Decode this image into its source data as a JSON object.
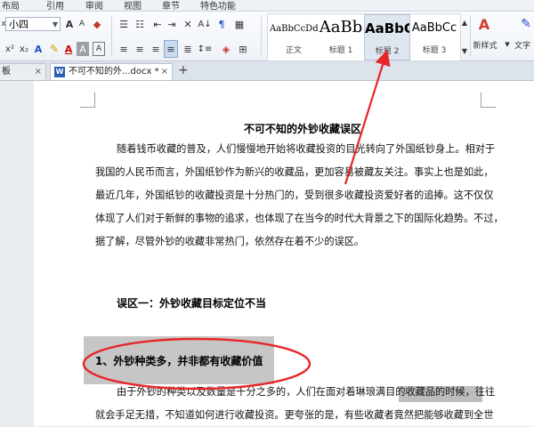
{
  "menubar": {
    "items": [
      "布局",
      "引用",
      "审阅",
      "视图",
      "章节",
      "特色功能"
    ]
  },
  "ribbon": {
    "font_size": "小四",
    "styles": [
      {
        "sample": "AaBbCcDd",
        "name": "正文"
      },
      {
        "sample": "AaBb",
        "name": "标题 1"
      },
      {
        "sample": "AaBbC",
        "name": "标题 2"
      },
      {
        "sample": "AaBbCc",
        "name": "标题 3"
      }
    ],
    "new_style_label": "新样式",
    "text_tools_label": "文字"
  },
  "tabs": {
    "doc_tab_label": "不可不知的外...docx *",
    "left_tab_label": "板"
  },
  "document": {
    "title": "不可不知的外钞收藏误区",
    "paragraph1": [
      "随着钱币收藏的普及，人们慢慢地开始将收藏投资的目光转向了外国纸钞身上。相对于",
      "我国的人民币而言，外国纸钞作为新兴的收藏品，更加容易被藏友关注。事实上也是如此，",
      "最近几年，外国纸钞的收藏投资是十分热门的，受到很多收藏投资爱好者的追捧。这不仅仅",
      "体现了人们对于新鲜的事物的追求，也体现了在当今的时代大背景之下的国际化趋势。不过，",
      "据了解，尽管外钞的收藏非常热门，依然存在着不少的误区。"
    ],
    "heading_misarea": "误区一：外钞收藏目标定位不当",
    "heading_section": "1、外钞种类多，并非都有收藏价值",
    "paragraph2": [
      "由于外钞的种类以及数量是千分之多的，人们在面对着琳琅满目的收藏品的时候，往往",
      "就会手足无措，不知道如何进行收藏投资。更夸张的是，有些收藏者竟然把能够收藏到全世"
    ]
  },
  "colors": {
    "annotation_red": "#e8262a",
    "highlight_grey": "#c6c6c6"
  }
}
